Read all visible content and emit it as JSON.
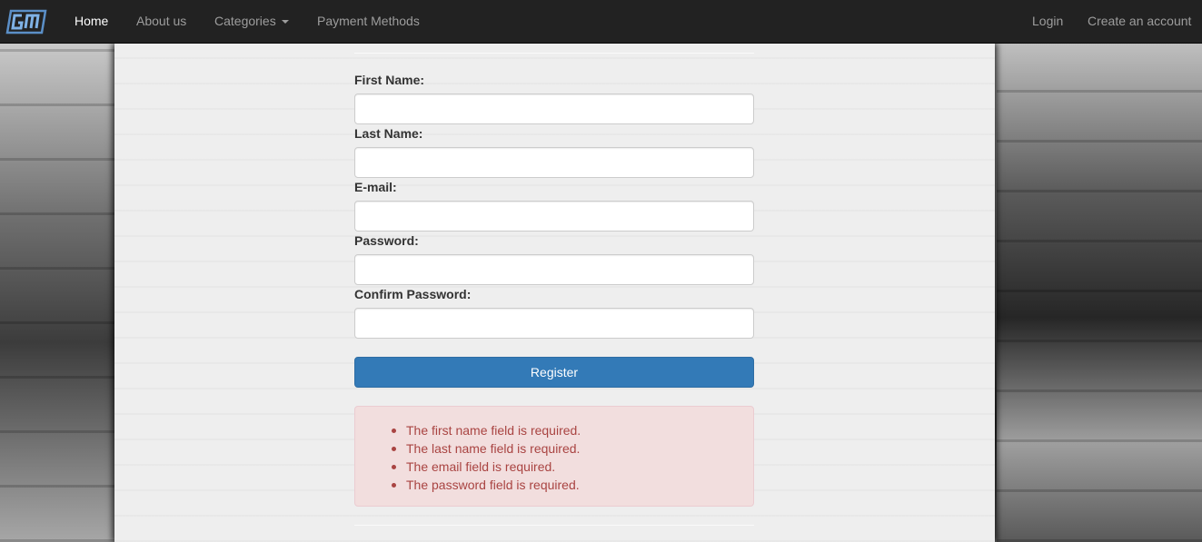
{
  "navbar": {
    "logo_icon": "brand-logo-icon",
    "items": [
      {
        "label": "Home",
        "active": true
      },
      {
        "label": "About us",
        "active": false
      },
      {
        "label": "Categories",
        "active": false,
        "dropdown": true
      },
      {
        "label": "Payment Methods",
        "active": false
      }
    ],
    "right_items": [
      {
        "label": "Login"
      },
      {
        "label": "Create an account"
      }
    ]
  },
  "form": {
    "fields": [
      {
        "label": "First Name:",
        "value": ""
      },
      {
        "label": "Last Name:",
        "value": ""
      },
      {
        "label": "E-mail:",
        "value": ""
      },
      {
        "label": "Password:",
        "value": ""
      },
      {
        "label": "Confirm Password:",
        "value": ""
      }
    ],
    "submit_label": "Register"
  },
  "errors": [
    "The first name field is required.",
    "The last name field is required.",
    "The email field is required.",
    "The password field is required."
  ],
  "colors": {
    "navbar_bg": "#222222",
    "primary": "#337ab7",
    "error_bg": "#f2dede",
    "error_text": "#a94442"
  }
}
